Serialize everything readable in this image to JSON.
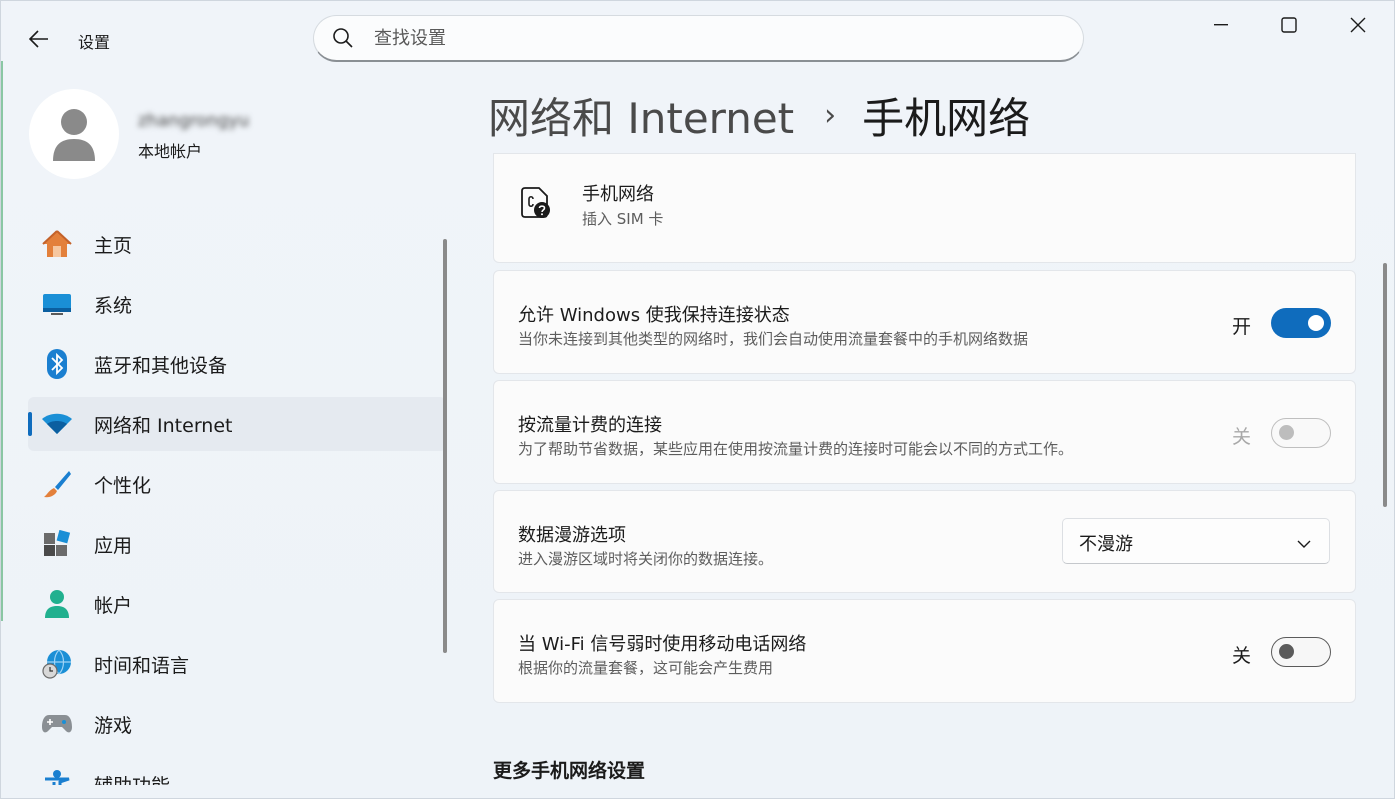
{
  "app": {
    "title": "设置"
  },
  "search": {
    "placeholder": "查找设置"
  },
  "user": {
    "name": "zhangrongyu",
    "account_type": "本地帐户"
  },
  "sidebar": {
    "items": [
      {
        "label": "主页",
        "icon": "home-icon"
      },
      {
        "label": "系统",
        "icon": "system-icon"
      },
      {
        "label": "蓝牙和其他设备",
        "icon": "bluetooth-icon"
      },
      {
        "label": "网络和 Internet",
        "icon": "wifi-icon",
        "active": true
      },
      {
        "label": "个性化",
        "icon": "brush-icon"
      },
      {
        "label": "应用",
        "icon": "apps-icon"
      },
      {
        "label": "帐户",
        "icon": "person-icon"
      },
      {
        "label": "时间和语言",
        "icon": "globe-clock-icon"
      },
      {
        "label": "游戏",
        "icon": "gamepad-icon"
      },
      {
        "label": "辅助功能",
        "icon": "accessibility-icon"
      }
    ]
  },
  "header": {
    "parent": "网络和 Internet",
    "separator": "›",
    "current": "手机网络"
  },
  "cards": {
    "sim": {
      "title": "手机网络",
      "desc": "插入 SIM 卡"
    },
    "keep_connected": {
      "title": "允许 Windows 使我保持连接状态",
      "desc": "当你未连接到其他类型的网络时，我们会自动使用流量套餐中的手机网络数据",
      "state_label": "开",
      "on": true
    },
    "metered": {
      "title": "按流量计费的连接",
      "desc": "为了帮助节省数据，某些应用在使用按流量计费的连接时可能会以不同的方式工作。",
      "state_label": "关",
      "on": false,
      "disabled": true
    },
    "roaming": {
      "title": "数据漫游选项",
      "desc": "进入漫游区域时将关闭你的数据连接。",
      "selected": "不漫游"
    },
    "wifi_fallback": {
      "title": "当 Wi-Fi 信号弱时使用移动电话网络",
      "desc": "根据你的流量套餐，这可能会产生费用",
      "state_label": "关",
      "on": false
    }
  },
  "more_section": {
    "title": "更多手机网络设置"
  },
  "colors": {
    "accent": "#0f6cbd"
  }
}
